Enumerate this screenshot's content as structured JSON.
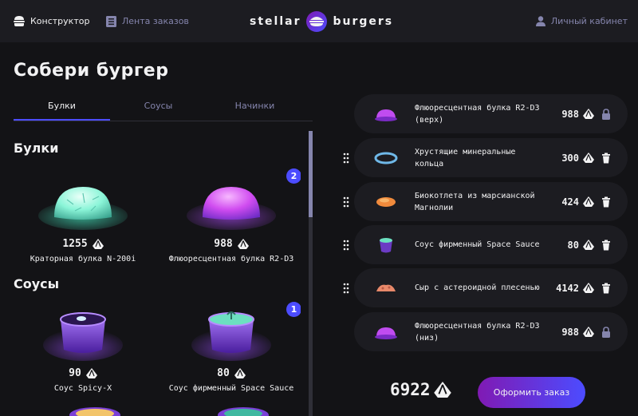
{
  "header": {
    "nav_constructor": "Конструктор",
    "nav_feed": "Лента заказов",
    "logo_left": "stellar",
    "logo_right": "burgers",
    "nav_account": "Личный кабинет"
  },
  "page_title": "Собери бургер",
  "tabs": [
    {
      "label": "Булки",
      "active": true
    },
    {
      "label": "Соусы",
      "active": false
    },
    {
      "label": "Начинки",
      "active": false
    }
  ],
  "sections": {
    "buns_title": "Булки",
    "sauces_title": "Соусы"
  },
  "buns": [
    {
      "price": "1255",
      "name": "Краторная булка N-200i",
      "count": null
    },
    {
      "price": "988",
      "name": "Флюоресцентная булка R2-D3",
      "count": "2"
    }
  ],
  "sauces": [
    {
      "price": "90",
      "name": "Соус Spicy-X",
      "count": null
    },
    {
      "price": "80",
      "name": "Соус фирменный Space Sauce",
      "count": "1"
    }
  ],
  "constructor": [
    {
      "name": "Флюоресцентная булка R2-D3 (верх)",
      "price": "988",
      "locked": true
    },
    {
      "name": "Хрустящие минеральные кольца",
      "price": "300",
      "locked": false
    },
    {
      "name": "Биокотлета из марсианской Магнолии",
      "price": "424",
      "locked": false
    },
    {
      "name": "Соус фирменный Space Sauce",
      "price": "80",
      "locked": false
    },
    {
      "name": "Сыр с астероидной плесенью",
      "price": "4142",
      "locked": false
    },
    {
      "name": "Флюоресцентная булка R2-D3 (низ)",
      "price": "988",
      "locked": true
    }
  ],
  "total": "6922",
  "order_button": "Оформить заказ",
  "colors": {
    "accent": "#4C4CFF",
    "background": "#131316",
    "card": "#1C1C21",
    "inactive": "#8585AD"
  },
  "icons": {
    "currency": "currency-icon",
    "lock": "lock-icon",
    "delete": "trash-icon",
    "drag": "drag-icon"
  }
}
